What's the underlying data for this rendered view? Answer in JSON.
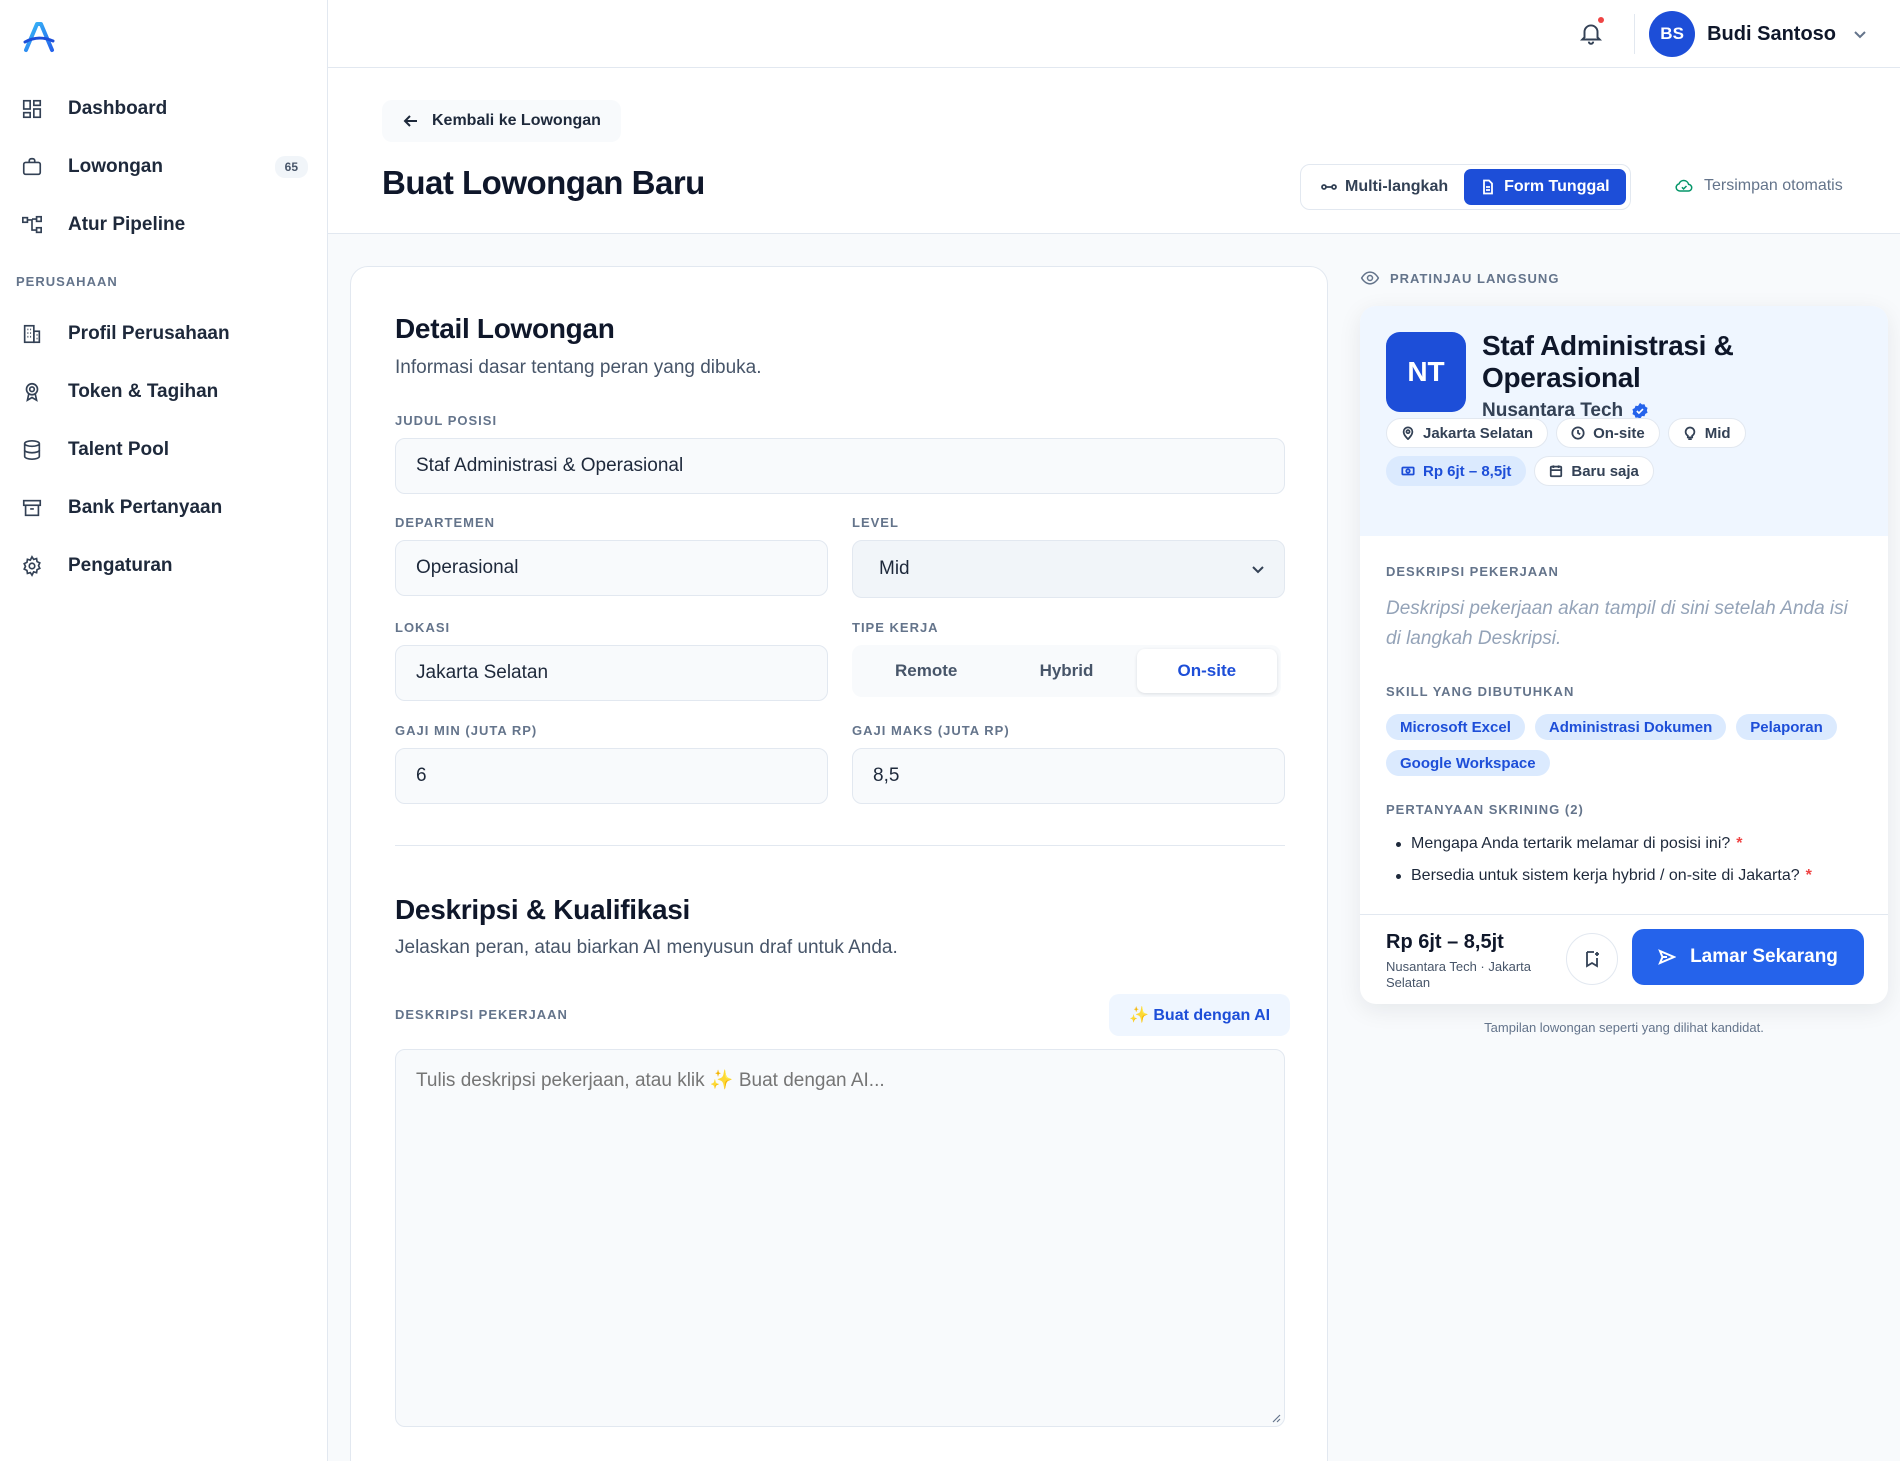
{
  "sidebar": {
    "items": [
      {
        "label": "Dashboard",
        "icon": "dashboard-icon"
      },
      {
        "label": "Lowongan",
        "icon": "briefcase-icon",
        "badge": "65"
      },
      {
        "label": "Atur Pipeline",
        "icon": "pipeline-icon"
      }
    ],
    "section_label": "PERUSAHAAN",
    "company_items": [
      {
        "label": "Profil Perusahaan",
        "icon": "building-icon"
      },
      {
        "label": "Token & Tagihan",
        "icon": "award-icon"
      },
      {
        "label": "Talent Pool",
        "icon": "database-icon"
      },
      {
        "label": "Bank Pertanyaan",
        "icon": "archive-icon"
      },
      {
        "label": "Pengaturan",
        "icon": "gear-icon"
      }
    ]
  },
  "topbar": {
    "user_initials": "BS",
    "user_name": "Budi Santoso"
  },
  "header": {
    "back_label": "Kembali ke Lowongan",
    "title": "Buat Lowongan Baru",
    "mode_multi": "Multi-langkah",
    "mode_single": "Form Tunggal",
    "autosave": "Tersimpan otomatis"
  },
  "form": {
    "detail_title": "Detail Lowongan",
    "detail_sub": "Informasi dasar tentang peran yang dibuka.",
    "judul_label": "JUDUL POSISI",
    "judul_value": "Staf Administrasi & Operasional",
    "departemen_label": "DEPARTEMEN",
    "departemen_value": "Operasional",
    "level_label": "LEVEL",
    "level_value": "Mid",
    "lokasi_label": "LOKASI",
    "lokasi_value": "Jakarta Selatan",
    "tipe_label": "TIPE KERJA",
    "tipe_options": [
      "Remote",
      "Hybrid",
      "On-site"
    ],
    "tipe_selected": "On-site",
    "gaji_min_label": "GAJI MIN (JUTA RP)",
    "gaji_min_value": "6",
    "gaji_max_label": "GAJI MAKS (JUTA RP)",
    "gaji_max_value": "8,5",
    "desc_title": "Deskripsi & Kualifikasi",
    "desc_sub": "Jelaskan peran, atau biarkan AI menyusun draf untuk Anda.",
    "deskripsi_label": "DESKRIPSI PEKERJAAN",
    "ai_button": "✨ Buat dengan AI",
    "deskripsi_placeholder": "Tulis deskripsi pekerjaan, atau klik ✨ Buat dengan AI..."
  },
  "preview": {
    "label": "PRATINJAU LANGSUNG",
    "logo_initials": "NT",
    "job_title": "Staf Administrasi & Operasional",
    "company": "Nusantara Tech",
    "chips": [
      {
        "text": "Jakarta Selatan",
        "icon": "map-pin-icon"
      },
      {
        "text": "On-site",
        "icon": "clock-icon"
      },
      {
        "text": "Mid",
        "icon": "lightbulb-icon"
      },
      {
        "text": "Rp 6jt – 8,5jt",
        "icon": "cash-icon"
      },
      {
        "text": "Baru saja",
        "icon": "calendar-icon"
      }
    ],
    "desc_label": "DESKRIPSI PEKERJAAN",
    "desc_placeholder": "Deskripsi pekerjaan akan tampil di sini setelah Anda isi di langkah Deskripsi.",
    "skills_label": "SKILL YANG DIBUTUHKAN",
    "skills": [
      "Microsoft Excel",
      "Administrasi Dokumen",
      "Pelaporan",
      "Google Workspace"
    ],
    "questions_label": "PERTANYAAN SKRINING (2)",
    "questions": [
      "Mengapa Anda tertarik melamar di posisi ini?",
      "Bersedia untuk sistem kerja hybrid / on-site di Jakarta?"
    ],
    "required_mark": "*",
    "salary": "Rp 6jt – 8,5jt",
    "salary_sub": "Nusantara Tech · Jakarta Selatan",
    "apply_label": "Lamar Sekarang",
    "caption": "Tampilan lowongan seperti yang dilihat kandidat."
  },
  "colors": {
    "accent": "#1d4ed8",
    "apply_button": "#2563eb",
    "autosave_icon": "#059669",
    "required": "#ef4444"
  }
}
